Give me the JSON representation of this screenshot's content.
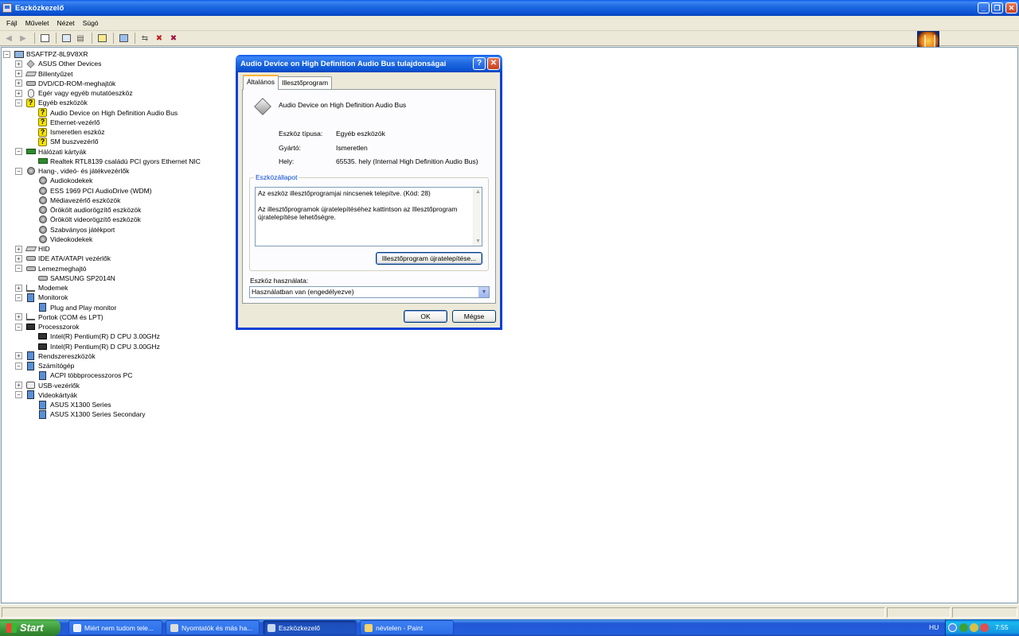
{
  "window": {
    "title": "Eszközkezelő"
  },
  "menu": [
    "Fájl",
    "Művelet",
    "Nézet",
    "Súgó"
  ],
  "tree": [
    {
      "label": "BSAFTPZ-8L9V8XR",
      "level": 0,
      "exp": "−",
      "icon": "computer"
    },
    {
      "label": "ASUS Other Devices",
      "level": 1,
      "exp": "+",
      "icon": "device"
    },
    {
      "label": "Billentyűzet",
      "level": 1,
      "exp": "+",
      "icon": "keyboard"
    },
    {
      "label": "DVD/CD-ROM-meghajtók",
      "level": 1,
      "exp": "+",
      "icon": "disk"
    },
    {
      "label": "Egér vagy egyéb mutatóeszköz",
      "level": 1,
      "exp": "+",
      "icon": "mouse"
    },
    {
      "label": "Egyéb eszközök",
      "level": 1,
      "exp": "−",
      "icon": "question"
    },
    {
      "label": "Audio Device on High Definition Audio Bus",
      "level": 2,
      "icon": "question"
    },
    {
      "label": "Ethernet-vezérlő",
      "level": 2,
      "icon": "question"
    },
    {
      "label": "Ismeretlen eszköz",
      "level": 2,
      "icon": "question"
    },
    {
      "label": "SM buszvezérlő",
      "level": 2,
      "icon": "question"
    },
    {
      "label": "Hálózati kártyák",
      "level": 1,
      "exp": "−",
      "icon": "network"
    },
    {
      "label": "Realtek RTL8139 családú PCI gyors Ethernet NIC",
      "level": 2,
      "icon": "network"
    },
    {
      "label": "Hang-, videó- és játékvezérlők",
      "level": 1,
      "exp": "−",
      "icon": "sound"
    },
    {
      "label": "Audiokodekek",
      "level": 2,
      "icon": "sound"
    },
    {
      "label": "ESS 1969 PCI AudioDrive (WDM)",
      "level": 2,
      "icon": "sound"
    },
    {
      "label": "Médiavezérlő eszközök",
      "level": 2,
      "icon": "sound"
    },
    {
      "label": "Örökölt audiorögzítő eszközök",
      "level": 2,
      "icon": "sound"
    },
    {
      "label": "Örökölt videorögzítő eszközök",
      "level": 2,
      "icon": "sound"
    },
    {
      "label": "Szabványos játékport",
      "level": 2,
      "icon": "sound"
    },
    {
      "label": "Videokodekek",
      "level": 2,
      "icon": "sound"
    },
    {
      "label": "HID",
      "level": 1,
      "exp": "+",
      "icon": "keyboard"
    },
    {
      "label": "IDE ATA/ATAPI vezérlők",
      "level": 1,
      "exp": "+",
      "icon": "disk"
    },
    {
      "label": "Lemezmeghajtó",
      "level": 1,
      "exp": "−",
      "icon": "disk"
    },
    {
      "label": "SAMSUNG SP2014N",
      "level": 2,
      "icon": "disk"
    },
    {
      "label": "Modemek",
      "level": 1,
      "exp": "+",
      "icon": "port"
    },
    {
      "label": "Monitorok",
      "level": 1,
      "exp": "−",
      "icon": "monitor"
    },
    {
      "label": "Plug and Play monitor",
      "level": 2,
      "icon": "monitor"
    },
    {
      "label": "Portok (COM és LPT)",
      "level": 1,
      "exp": "+",
      "icon": "port"
    },
    {
      "label": "Processzorok",
      "level": 1,
      "exp": "−",
      "icon": "cpu"
    },
    {
      "label": "Intel(R) Pentium(R) D CPU 3.00GHz",
      "level": 2,
      "icon": "cpu"
    },
    {
      "label": "Intel(R) Pentium(R) D CPU 3.00GHz",
      "level": 2,
      "icon": "cpu"
    },
    {
      "label": "Rendszereszközök",
      "level": 1,
      "exp": "+",
      "icon": "monitor"
    },
    {
      "label": "Számítógép",
      "level": 1,
      "exp": "−",
      "icon": "monitor"
    },
    {
      "label": "ACPI többprocesszoros PC",
      "level": 2,
      "icon": "monitor"
    },
    {
      "label": "USB-vezérlők",
      "level": 1,
      "exp": "+",
      "icon": "usb"
    },
    {
      "label": "Videokártyák",
      "level": 1,
      "exp": "−",
      "icon": "monitor"
    },
    {
      "label": "ASUS X1300 Series",
      "level": 2,
      "icon": "monitor"
    },
    {
      "label": "ASUS X1300 Series Secondary",
      "level": 2,
      "icon": "monitor"
    }
  ],
  "dialog": {
    "title": "Audio Device on High Definition Audio Bus tulajdonságai",
    "help_glyph": "?",
    "close_glyph": "✕",
    "tabs": [
      "Általános",
      "Illesztőprogram"
    ],
    "device_name": "Audio Device on High Definition Audio Bus",
    "type_label": "Eszköz típusa:",
    "type_value": "Egyéb eszközök",
    "maker_label": "Gyártó:",
    "maker_value": "Ismeretlen",
    "location_label": "Hely:",
    "location_value": "65535. hely (Internal High Definition Audio Bus)",
    "status_group": "Eszközállapot",
    "status_line1": "Az eszköz illesztőprogramjai nincsenek telepítve. (Kód: 28)",
    "status_line2": "Az illesztőprogramok újratelepítéséhez kattintson az Illesztőprogram újratelepítése lehetőségre.",
    "reinstall_button": "Illesztőprogram újratelepítése...",
    "usage_label": "Eszköz használata:",
    "usage_value": "Használatban van (engedélyezve)",
    "ok_button": "OK",
    "cancel_button": "Mégse"
  },
  "taskbar": {
    "start": "Start",
    "tasks": [
      "Miért nem tudom tele...",
      "Nyomtatók és más ha...",
      "Eszközkezelő",
      "névtelen - Paint"
    ],
    "active_task": 2,
    "lang": "HU",
    "clock": "7:55"
  }
}
